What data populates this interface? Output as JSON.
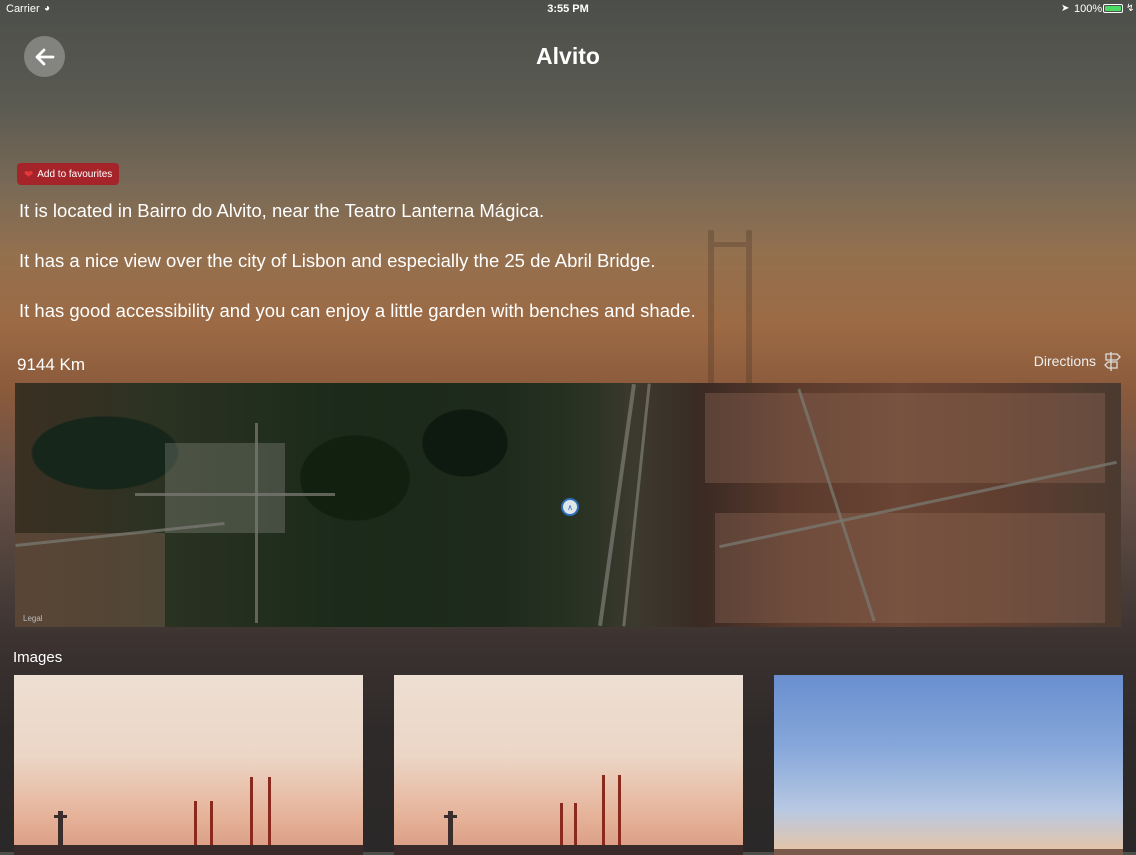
{
  "status_bar": {
    "carrier": "Carrier",
    "time": "3:55 PM",
    "battery": "100%"
  },
  "nav": {
    "title": "Alvito"
  },
  "favourite": {
    "label": "Add to favourites"
  },
  "description": [
    "It is located in Bairro do Alvito, near the Teatro Lanterna Mágica.",
    "It has a nice view over the city of Lisbon and especially the 25 de Abril Bridge.",
    "It has good accessibility and you can enjoy a little garden with benches and shade."
  ],
  "distance": "9144 Km",
  "directions_label": "Directions",
  "map": {
    "legal": "Legal"
  },
  "images": {
    "title": "Images"
  },
  "colors": {
    "favourite_button": "#a5242a",
    "battery": "#4cd964",
    "bridge": "#8a2a1f"
  }
}
